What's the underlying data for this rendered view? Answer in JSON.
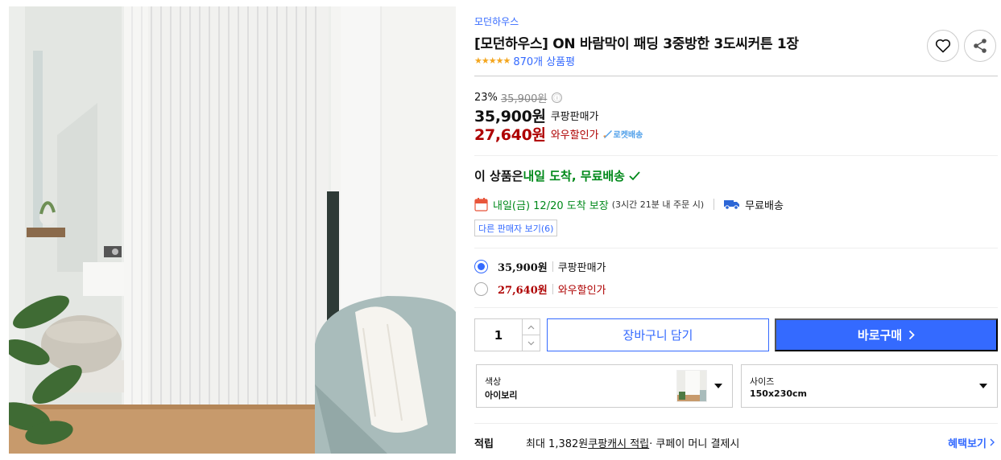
{
  "product": {
    "brand": "모던하우스",
    "title": "[모던하우스] ON 바람막이 패딩 3중방한 3도씨커튼 1장",
    "stars": "★★★★★",
    "review_count": "870개 상품평"
  },
  "pricing": {
    "discount_rate": "23%",
    "original_price": "35,900원",
    "info_icon": "ⓘ",
    "sale_price": "35,900원",
    "sale_label": "쿠팡판매가",
    "member_price": "27,640원",
    "member_label": "와우할인가",
    "rocket_label": "로켓배송"
  },
  "delivery": {
    "head_prefix": "이 상품은 ",
    "head_highlight": "내일 도착, 무료배송",
    "arrival": "내일(금) 12/20 도착 보장",
    "order_note": "(3시간 21분 내 주문 시)",
    "shipping": "무료배송",
    "other_sellers": "다른 판매자 보기(6)"
  },
  "options": [
    {
      "price": "35,900원",
      "label": "쿠팡판매가",
      "selected": true
    },
    {
      "price": "27,640원",
      "label": "와우할인가",
      "selected": false
    }
  ],
  "purchase": {
    "quantity": "1",
    "cart_label": "장바구니 담기",
    "buy_label": "바로구매"
  },
  "selectors": {
    "color_label": "색상",
    "color_value": "아이보리",
    "size_label": "사이즈",
    "size_value": "150x230cm"
  },
  "points": {
    "label": "적립",
    "text_prefix": "최대 1,382원 ",
    "cash_link": "쿠팡캐시 적립",
    "text_suffix": " · 쿠페이 머니 결제시",
    "benefit_link": "혜택보기"
  },
  "colors": {
    "accent": "#346aff",
    "sale_red": "#ae0000",
    "delivery_green": "#00891a",
    "star": "#f4a61e"
  }
}
